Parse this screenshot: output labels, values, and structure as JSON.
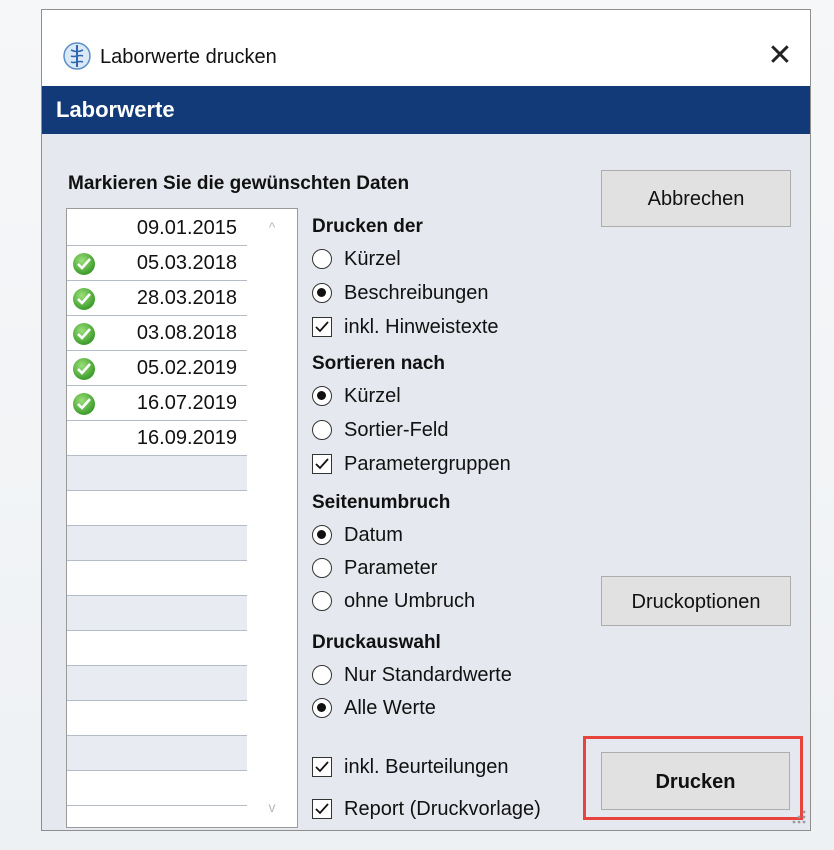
{
  "window": {
    "title": "Laborwerte drucken",
    "close_glyph": "✕",
    "icon": "app-caduceus-icon"
  },
  "banner": {
    "title": "Laborwerte"
  },
  "dates": {
    "heading": "Markieren Sie die gewünschten Daten",
    "rows": [
      {
        "date": "09.01.2015",
        "checked": false
      },
      {
        "date": "05.03.2018",
        "checked": true
      },
      {
        "date": "28.03.2018",
        "checked": true
      },
      {
        "date": "03.08.2018",
        "checked": true
      },
      {
        "date": "05.02.2019",
        "checked": true
      },
      {
        "date": "16.07.2019",
        "checked": true
      },
      {
        "date": "16.09.2019",
        "checked": false
      }
    ],
    "scroll_up": "^",
    "scroll_down": "v"
  },
  "print_of": {
    "heading": "Drucken der",
    "options": [
      "Kürzel",
      "Beschreibungen"
    ],
    "selected": "Beschreibungen",
    "include_notes_label": "inkl. Hinweistexte",
    "include_notes": true
  },
  "sort_by": {
    "heading": "Sortieren nach",
    "options": [
      "Kürzel",
      "Sortier-Feld"
    ],
    "selected": "Kürzel",
    "groups_label": "Parametergruppen",
    "groups": true
  },
  "page_break": {
    "heading": "Seitenumbruch",
    "options": [
      "Datum",
      "Parameter",
      "ohne Umbruch"
    ],
    "selected": "Datum"
  },
  "print_selection": {
    "heading": "Druckauswahl",
    "options": [
      "Nur Standardwerte",
      "Alle Werte"
    ],
    "selected": "Alle Werte"
  },
  "extras": {
    "assessments_label": "inkl. Beurteilungen",
    "assessments": true,
    "report_label": "Report (Druckvorlage)",
    "report": true
  },
  "buttons": {
    "cancel": "Abbrechen",
    "print_options": "Druckoptionen",
    "print": "Drucken"
  },
  "colors": {
    "banner": "#123a78",
    "highlight": "#e8433d",
    "check_green": "#3f9e2d"
  }
}
